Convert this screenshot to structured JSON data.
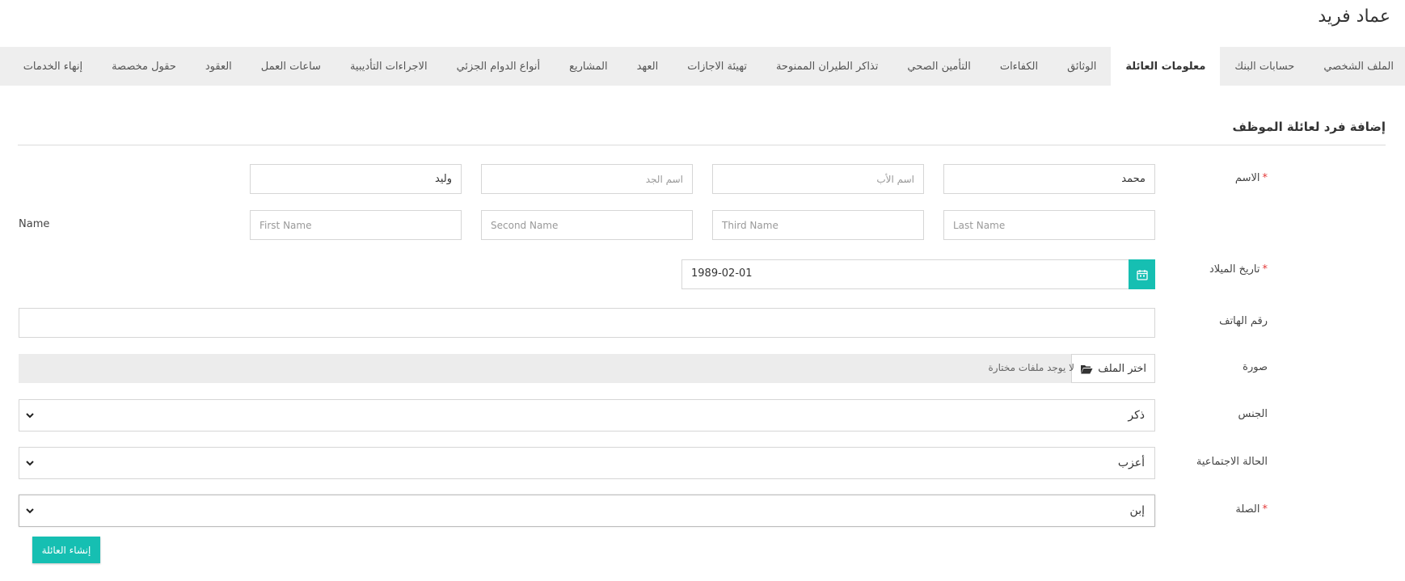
{
  "header": {
    "employee_name": "عماد فريد"
  },
  "tabs": [
    {
      "label": "الملف الشخصي"
    },
    {
      "label": "حسابات البنك"
    },
    {
      "label": "معلومات العائلة",
      "active": true
    },
    {
      "label": "الوثائق"
    },
    {
      "label": "الكفاءات"
    },
    {
      "label": "التأمين الصحي"
    },
    {
      "label": "تذاكر الطيران الممنوحة"
    },
    {
      "label": "تهيئة الاجازات"
    },
    {
      "label": "العهد"
    },
    {
      "label": "المشاريع"
    },
    {
      "label": "أنواع الدوام الجزئي"
    },
    {
      "label": "الاجراءات التأديبية"
    },
    {
      "label": "ساعات العمل"
    },
    {
      "label": "العقود"
    },
    {
      "label": "حقول مخصصة"
    },
    {
      "label": "إنهاء الخدمات"
    }
  ],
  "form": {
    "title": "إضافة فرد لعائلة الموظف",
    "name_label": "الاسم",
    "required_mark": "*",
    "name_ar": {
      "first_value": "محمد",
      "father_placeholder": "اسم الأب",
      "grandfather_placeholder": "اسم الجد",
      "family_value": "وليد"
    },
    "name_en_label": "Name",
    "name_en": {
      "last_placeholder": "Last Name",
      "third_placeholder": "Third Name",
      "second_placeholder": "Second Name",
      "first_placeholder": "First Name"
    },
    "birthdate_label": "تاريخ الميلاد",
    "birthdate_value": "1989-02-01",
    "phone_label": "رقم الهاتف",
    "phone_value": "",
    "photo_label": "صورة",
    "choose_file_label": "اختر الملف",
    "no_file_text": "لا يوجد ملفات مختارة",
    "gender_label": "الجنس",
    "gender_value": "ذكر",
    "marital_label": "الحالة الاجتماعية",
    "marital_value": "أعزب",
    "relation_label": "الصلة",
    "relation_value": "إبن",
    "submit_label": "إنشاء العائلة"
  },
  "colors": {
    "accent": "#16bfb2",
    "required": "#e43a3a",
    "tab_bar": "#eeeeee"
  },
  "icons": {
    "calendar": "calendar-icon",
    "folder": "folder-open-icon",
    "caret": "chevron-down-icon"
  }
}
